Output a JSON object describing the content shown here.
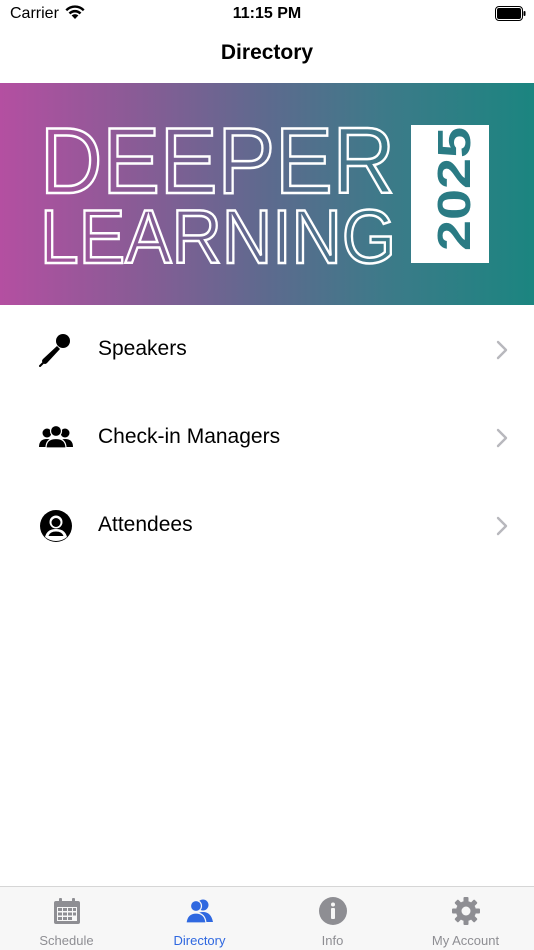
{
  "status_bar": {
    "carrier": "Carrier",
    "time": "11:15 PM"
  },
  "nav": {
    "title": "Directory"
  },
  "banner": {
    "line1": "DEEPER",
    "line2": "LEARNING",
    "year": "2025"
  },
  "list": [
    {
      "label": "Speakers",
      "icon": "microphone-icon"
    },
    {
      "label": "Check-in Managers",
      "icon": "group-icon"
    },
    {
      "label": "Attendees",
      "icon": "user-circle-icon"
    }
  ],
  "tabs": [
    {
      "label": "Schedule",
      "icon": "calendar-icon",
      "active": false
    },
    {
      "label": "Directory",
      "icon": "users-icon",
      "active": true
    },
    {
      "label": "Info",
      "icon": "info-icon",
      "active": false
    },
    {
      "label": "My Account",
      "icon": "gear-icon",
      "active": false
    }
  ],
  "colors": {
    "accent": "#2f68e0",
    "inactive_tab": "#8e8e93",
    "banner_start": "#b44fa1",
    "banner_end": "#1b8580",
    "year_text": "#2a7b84"
  }
}
